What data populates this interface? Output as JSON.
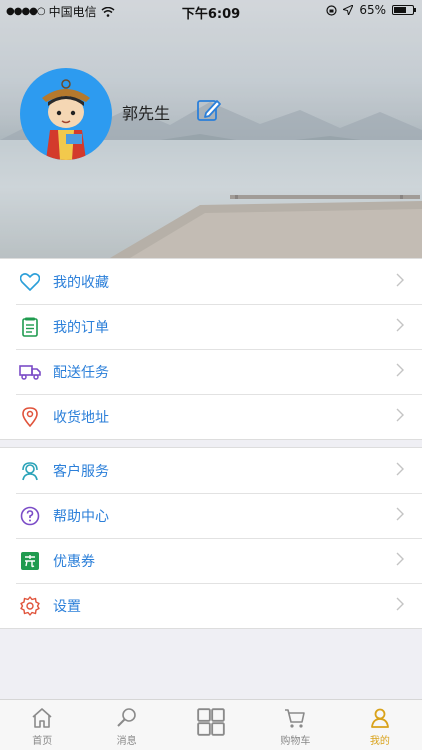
{
  "status_bar": {
    "signal": "●●●●○",
    "carrier": "中国电信",
    "time": "下午6:09",
    "battery_text": "65%"
  },
  "profile": {
    "username": "郭先生"
  },
  "menu_group_1": [
    {
      "label": "我的收藏",
      "icon": "heart-icon"
    },
    {
      "label": "我的订单",
      "icon": "order-icon"
    },
    {
      "label": "配送任务",
      "icon": "truck-icon"
    },
    {
      "label": "收货地址",
      "icon": "location-icon"
    }
  ],
  "menu_group_2": [
    {
      "label": "客户服务",
      "icon": "customer-service-icon"
    },
    {
      "label": "帮助中心",
      "icon": "help-icon"
    },
    {
      "label": "优惠券",
      "icon": "coupon-icon"
    },
    {
      "label": "设置",
      "icon": "settings-icon"
    }
  ],
  "tabbar": [
    {
      "label": "首页",
      "icon": "home-icon"
    },
    {
      "label": "消息",
      "icon": "message-icon"
    },
    {
      "label": "",
      "icon": "grid-icon"
    },
    {
      "label": "购物车",
      "icon": "cart-icon"
    },
    {
      "label": "我的",
      "icon": "user-icon"
    }
  ],
  "colors": {
    "accent": "#2b7fd9",
    "active_tab": "#d9a21a",
    "avatar_bg": "#2d9bf0"
  }
}
